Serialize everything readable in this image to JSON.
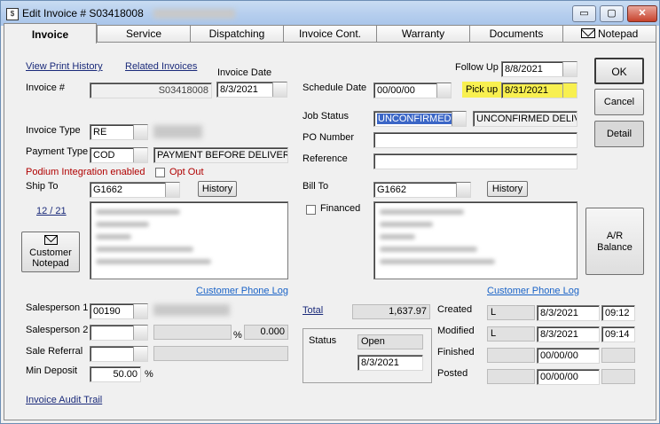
{
  "window": {
    "title": "Edit Invoice # S03418008",
    "min": "▭",
    "max": "▢",
    "close": "✕"
  },
  "tabs": [
    "Invoice",
    "Service",
    "Dispatching",
    "Invoice Cont.",
    "Warranty",
    "Documents",
    "Notepad"
  ],
  "links": {
    "view_print_history": "View Print History",
    "related_invoices": "Related Invoices",
    "customer_phone_log_ship": "Customer Phone Log",
    "customer_phone_log_bill": "Customer Phone Log",
    "invoice_audit_trail": "Invoice Audit Trail",
    "total": "Total",
    "page_count": "12 / 21"
  },
  "labels": {
    "invoice_number": "Invoice #",
    "invoice_date": "Invoice Date",
    "schedule_date": "Schedule Date",
    "follow_up": "Follow Up",
    "pick_up": "Pick up",
    "invoice_type": "Invoice Type",
    "job_status": "Job Status",
    "payment_type": "Payment Type",
    "po_number": "PO Number",
    "reference": "Reference",
    "podium": "Podium Integration enabled",
    "opt_out": "Opt Out",
    "ship_to": "Ship To",
    "bill_to": "Bill To",
    "financed": "Financed",
    "salesperson1": "Salesperson 1",
    "salesperson2": "Salesperson 2",
    "sale_referral": "Sale Referral",
    "min_deposit": "Min Deposit",
    "percent": "%",
    "status": "Status",
    "created": "Created",
    "modified": "Modified",
    "finished": "Finished",
    "posted": "Posted"
  },
  "fields": {
    "invoice_number": "S03418008",
    "invoice_date": "8/3/2021",
    "schedule_date": "00/00/00",
    "follow_up": "8/8/2021",
    "pick_up": "8/31/2021",
    "invoice_type": "RE",
    "job_status_code": "UNCONFIRMED",
    "job_status_desc": "UNCONFIRMED DELIV",
    "payment_type": "COD",
    "payment_desc": "PAYMENT BEFORE DELIVER",
    "ship_to": "G1662",
    "bill_to": "G1662",
    "salesperson1": "00190",
    "salesperson2_pct": "0.000",
    "min_deposit": "50.00",
    "total": "1,637.97",
    "status_value": "Open",
    "status_date": "8/3/2021",
    "created_user": "L",
    "created_date": "8/3/2021",
    "created_time": "09:12",
    "modified_user": "L",
    "modified_date": "8/3/2021",
    "modified_time": "09:14",
    "finished_date": "00/00/00",
    "posted_date": "00/00/00"
  },
  "buttons": {
    "ok": "OK",
    "cancel": "Cancel",
    "detail": "Detail",
    "history_ship": "History",
    "history_bill": "History",
    "customer_notepad_line1": "Customer",
    "customer_notepad_line2": "Notepad",
    "ar_line1": "A/R",
    "ar_line2": "Balance"
  },
  "colors": {
    "highlight": "#f8f050",
    "podium_red": "#b00000",
    "selection": "#3b66c6"
  }
}
